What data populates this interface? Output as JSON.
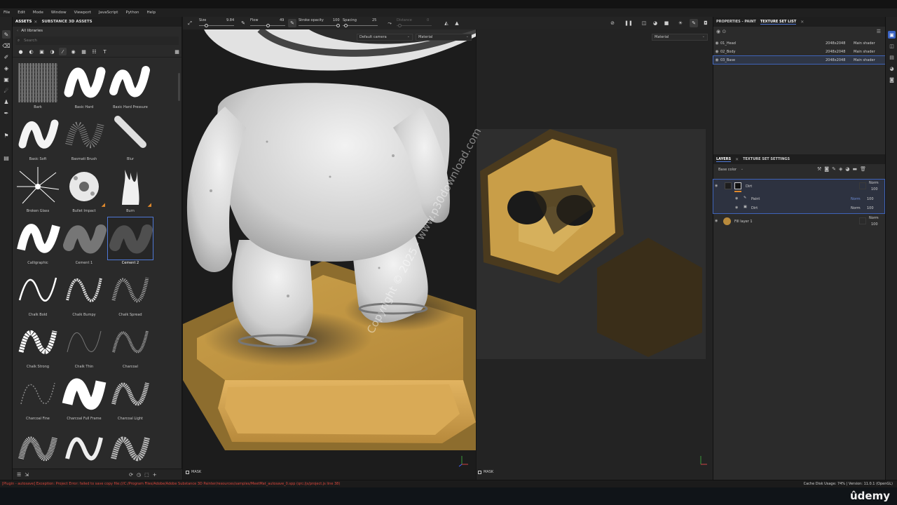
{
  "menu": [
    "File",
    "Edit",
    "Mode",
    "Window",
    "Viewport",
    "JavaScript",
    "Python",
    "Help"
  ],
  "assets_panel": {
    "tabs": [
      "ASSETS",
      "SUBSTANCE 3D ASSETS"
    ],
    "library": "All libraries",
    "search_placeholder": "Search",
    "brushes": [
      "Bark",
      "Basic Hard",
      "Basic Hard Pressure",
      "Basic Soft",
      "Basmati Brush",
      "Blur",
      "Broken Glass",
      "Bullet Impact",
      "Burn",
      "Calligraphic",
      "Cement 1",
      "Cement 2",
      "Chalk Bold",
      "Chalk Bumpy",
      "Chalk Spread",
      "Chalk Strong",
      "Chalk Thin",
      "Charcoal",
      "Charcoal Fine",
      "Charcoal Full Frame",
      "Charcoal Light"
    ],
    "selected_brush": "Cement 2"
  },
  "context_toolbar": {
    "size_label": "Size",
    "size_value": "9.84",
    "size_fraction": 0.2,
    "flow_label": "Flow",
    "flow_value": "49",
    "flow_fraction": 0.5,
    "stroke_opacity_label": "Stroke opacity",
    "stroke_opacity_value": "100",
    "spacing_label": "Spacing",
    "spacing_value": "25",
    "distance_label": "Distance",
    "distance_value": "0"
  },
  "viewport_3d": {
    "camera_select": "Default camera",
    "channel_select": "Material",
    "mask_label": "MASK"
  },
  "viewport_2d": {
    "channel_select": "Material",
    "mask_label": "MASK"
  },
  "watermark": "Copyright © 2025 - www.p30download.com",
  "texture_set_panel": {
    "tabs": [
      "PROPERTIES - PAINT",
      "TEXTURE SET LIST"
    ],
    "rows": [
      {
        "name": "01_Head",
        "res": "2048x2048",
        "shader": "Main shader"
      },
      {
        "name": "02_Body",
        "res": "2048x2048",
        "shader": "Main shader"
      },
      {
        "name": "03_Base",
        "res": "2048x2048",
        "shader": "Main shader"
      }
    ]
  },
  "layers_panel": {
    "tabs": [
      "LAYERS",
      "TEXTURE SET SETTINGS"
    ],
    "channel": "Base color",
    "layers": [
      {
        "name": "Dirt",
        "blend": "Norm",
        "opacity": "100"
      },
      {
        "name": "Paint",
        "blend": "Norm",
        "opacity": "100"
      },
      {
        "name": "Dirt",
        "blend": "Norm",
        "opacity": "100"
      },
      {
        "name": "Fill layer 1",
        "blend": "Norm",
        "opacity": "100"
      }
    ]
  },
  "status": {
    "error": "[Plugin - autosave] Exception: Project Error: failed to save copy file:///C:/Program Files/Adobe/Adobe Substance 3D Painter/resources/samples/MeetMat_autosave_0.spp (qrc:/js/project.js line 38)",
    "right": "Cache Disk Usage:  74% | Version: 11.0.1 (OpenGL)"
  },
  "brand": "ûdemy",
  "colors": {
    "accent": "#4f78d6",
    "error": "#d9463c",
    "gold": "#c9a13c"
  }
}
